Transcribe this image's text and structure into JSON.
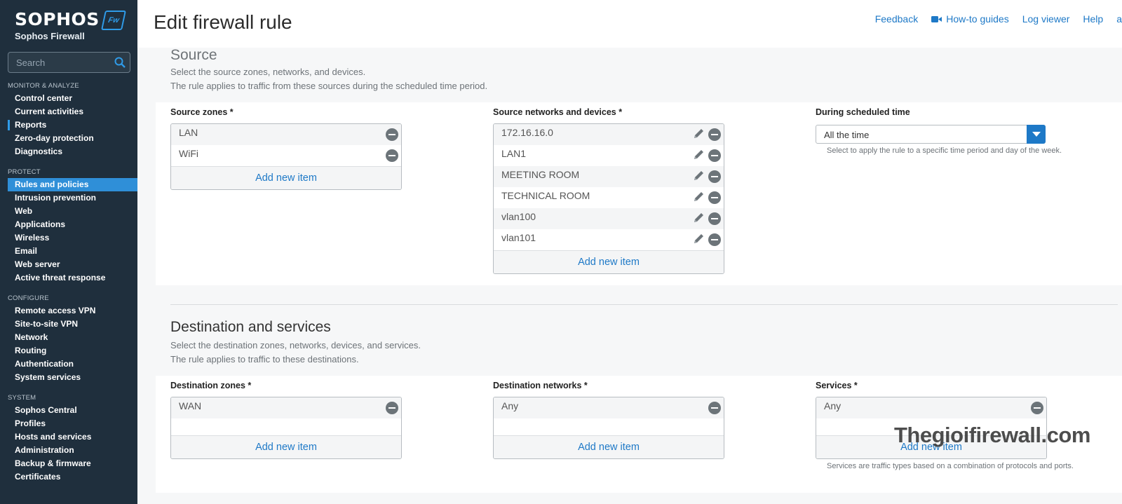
{
  "brand": {
    "logo": "SOPHOS",
    "subtitle": "Sophos Firewall",
    "badge": "Fw"
  },
  "search": {
    "placeholder": "Search"
  },
  "nav": {
    "monitor": {
      "title": "MONITOR & ANALYZE",
      "items": [
        "Control center",
        "Current activities",
        "Reports",
        "Zero-day protection",
        "Diagnostics"
      ]
    },
    "protect": {
      "title": "PROTECT",
      "items": [
        "Rules and policies",
        "Intrusion prevention",
        "Web",
        "Applications",
        "Wireless",
        "Email",
        "Web server",
        "Active threat response"
      ]
    },
    "configure": {
      "title": "CONFIGURE",
      "items": [
        "Remote access VPN",
        "Site-to-site VPN",
        "Network",
        "Routing",
        "Authentication",
        "System services"
      ]
    },
    "system": {
      "title": "SYSTEM",
      "items": [
        "Sophos Central",
        "Profiles",
        "Hosts and services",
        "Administration",
        "Backup & firmware",
        "Certificates"
      ]
    }
  },
  "header": {
    "title": "Edit firewall rule",
    "links": {
      "feedback": "Feedback",
      "howto": "How-to guides",
      "logviewer": "Log viewer",
      "help": "Help",
      "overflow": "a"
    }
  },
  "source": {
    "title": "Source",
    "desc1": "Select the source zones, networks, and devices.",
    "desc2": "The rule applies to traffic from these sources during the scheduled time period.",
    "zones": {
      "label": "Source zones *",
      "items": [
        "LAN",
        "WiFi"
      ],
      "add": "Add new item"
    },
    "networks": {
      "label": "Source networks and devices *",
      "items": [
        "172.16.16.0",
        "LAN1",
        "MEETING ROOM",
        "TECHNICAL ROOM",
        "vlan100",
        "vlan101"
      ],
      "add": "Add new item"
    },
    "schedule": {
      "label": "During scheduled time",
      "value": "All the time",
      "hint": "Select to apply the rule to a specific time period and day of the week."
    }
  },
  "destination": {
    "title": "Destination and services",
    "desc1": "Select the destination zones, networks, devices, and services.",
    "desc2": "The rule applies to traffic to these destinations.",
    "zones": {
      "label": "Destination zones *",
      "items": [
        "WAN"
      ],
      "add": "Add new item"
    },
    "networks": {
      "label": "Destination networks *",
      "items": [
        "Any"
      ],
      "add": "Add new item"
    },
    "services": {
      "label": "Services *",
      "items": [
        "Any"
      ],
      "add": "Add new item",
      "hint": "Services are traffic types based on a combination of protocols and ports."
    }
  },
  "watermark": "Thegioifirewall.com",
  "colors": {
    "sidebar": "#1f2f3d",
    "accent": "#1e79c7",
    "active_nav": "#2f8fd8"
  }
}
